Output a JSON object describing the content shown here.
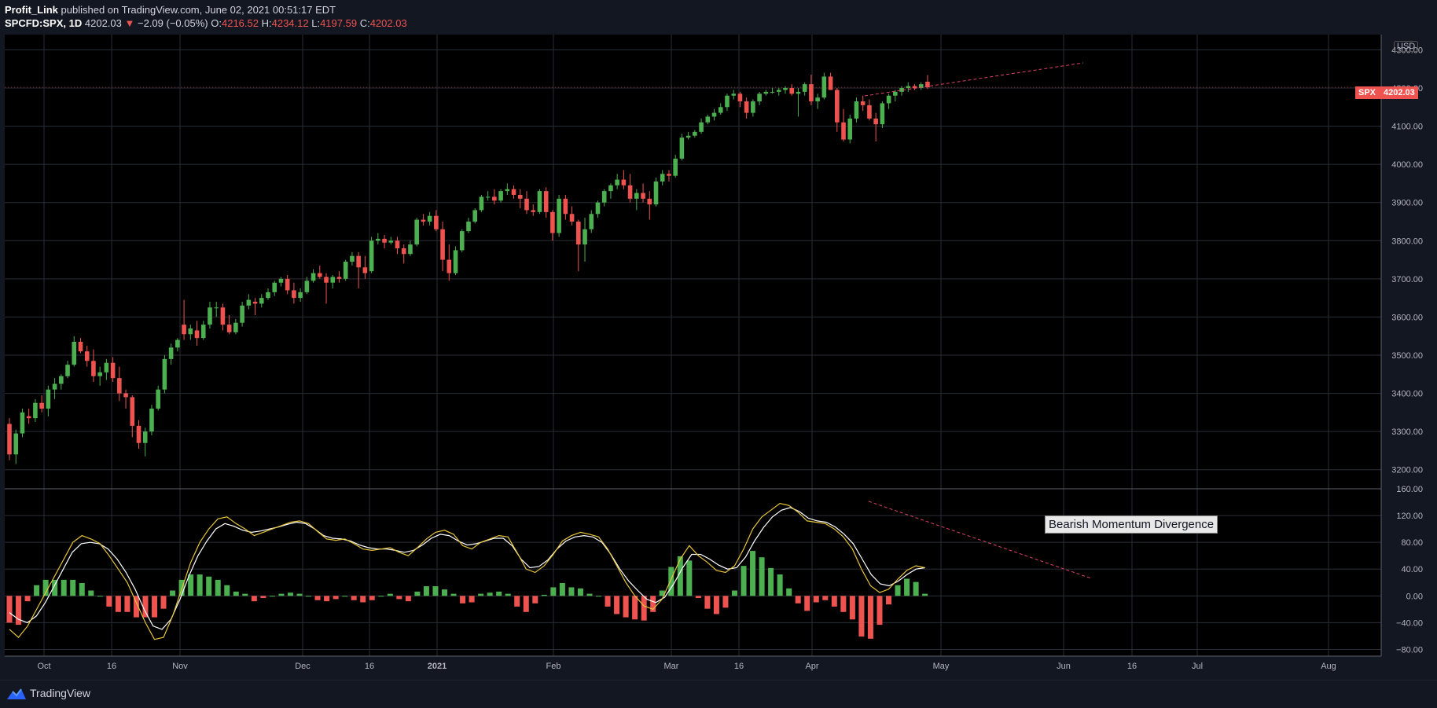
{
  "header": {
    "publisher": "Profit_Link",
    "published_text": "published on TradingView.com, June 02, 2021 00:51:17 EDT",
    "symbol": "SPCFD:SPX, 1D",
    "last": "4202.03",
    "change": "−2.09 (−0.05%)",
    "o_label": "O:",
    "o_value": "4216.52",
    "h_label": "H:",
    "h_value": "4234.12",
    "l_label": "L:",
    "l_value": "4197.59",
    "c_label": "C:",
    "c_value": "4202.03"
  },
  "price_scale": {
    "currency": "USD",
    "badge_symbol": "SPX",
    "badge_value": "4202.03"
  },
  "annotation": "Bearish Momentum Divergence",
  "footer": {
    "brand": "TradingView"
  },
  "colors": {
    "up": "#4caf50",
    "down": "#ef5350",
    "grid": "#2a2e39",
    "osc_fast": "#e7c53a",
    "osc_slow": "#ffffff",
    "trendline": "#e0436b"
  },
  "chart_data": [
    {
      "type": "candlestick",
      "x_ticks": [
        "Oct",
        "16",
        "Nov",
        "Dec",
        "16",
        "2021",
        "Feb",
        "Mar",
        "16",
        "Apr",
        "May",
        "Jun",
        "16",
        "Jul",
        "Aug"
      ],
      "y_ticks": [
        "4300.00",
        "4200.00",
        "4100.00",
        "4000.00",
        "3900.00",
        "3800.00",
        "3700.00",
        "3600.00",
        "3500.00",
        "3400.00",
        "3300.00",
        "3200.00"
      ],
      "ylim": [
        3150,
        4340
      ],
      "ohlc_key": [
        "open",
        "high",
        "low",
        "close"
      ],
      "candles": [
        [
          3320,
          3335,
          3225,
          3240
        ],
        [
          3240,
          3305,
          3215,
          3295
        ],
        [
          3295,
          3360,
          3285,
          3350
        ],
        [
          3340,
          3360,
          3320,
          3335
        ],
        [
          3335,
          3385,
          3325,
          3375
        ],
        [
          3375,
          3395,
          3350,
          3360
        ],
        [
          3360,
          3420,
          3340,
          3410
        ],
        [
          3410,
          3440,
          3385,
          3425
        ],
        [
          3425,
          3450,
          3410,
          3445
        ],
        [
          3445,
          3485,
          3440,
          3475
        ],
        [
          3475,
          3550,
          3470,
          3535
        ],
        [
          3535,
          3545,
          3505,
          3510
        ],
        [
          3510,
          3525,
          3470,
          3485
        ],
        [
          3485,
          3515,
          3430,
          3445
        ],
        [
          3445,
          3470,
          3420,
          3455
        ],
        [
          3455,
          3490,
          3435,
          3480
        ],
        [
          3480,
          3495,
          3430,
          3440
        ],
        [
          3440,
          3470,
          3380,
          3400
        ],
        [
          3400,
          3410,
          3360,
          3390
        ],
        [
          3390,
          3395,
          3285,
          3315
        ],
        [
          3315,
          3330,
          3255,
          3270
        ],
        [
          3270,
          3310,
          3235,
          3300
        ],
        [
          3300,
          3370,
          3290,
          3360
        ],
        [
          3360,
          3420,
          3355,
          3410
        ],
        [
          3410,
          3500,
          3400,
          3490
        ],
        [
          3490,
          3530,
          3475,
          3520
        ],
        [
          3520,
          3545,
          3510,
          3540
        ],
        [
          3580,
          3645,
          3540,
          3555
        ],
        [
          3555,
          3580,
          3540,
          3570
        ],
        [
          3565,
          3590,
          3525,
          3545
        ],
        [
          3545,
          3590,
          3540,
          3580
        ],
        [
          3580,
          3640,
          3570,
          3625
        ],
        [
          3625,
          3640,
          3600,
          3625
        ],
        [
          3625,
          3635,
          3565,
          3580
        ],
        [
          3580,
          3605,
          3555,
          3560
        ],
        [
          3560,
          3595,
          3555,
          3585
        ],
        [
          3585,
          3640,
          3575,
          3630
        ],
        [
          3630,
          3660,
          3620,
          3645
        ],
        [
          3640,
          3650,
          3605,
          3635
        ],
        [
          3635,
          3660,
          3625,
          3650
        ],
        [
          3650,
          3675,
          3645,
          3665
        ],
        [
          3665,
          3695,
          3655,
          3690
        ],
        [
          3690,
          3705,
          3680,
          3700
        ],
        [
          3700,
          3710,
          3660,
          3670
        ],
        [
          3670,
          3690,
          3635,
          3650
        ],
        [
          3650,
          3675,
          3640,
          3665
        ],
        [
          3665,
          3705,
          3660,
          3695
        ],
        [
          3695,
          3725,
          3690,
          3715
        ],
        [
          3715,
          3735,
          3700,
          3705
        ],
        [
          3705,
          3715,
          3635,
          3690
        ],
        [
          3690,
          3710,
          3675,
          3705
        ],
        [
          3705,
          3720,
          3690,
          3700
        ],
        [
          3700,
          3750,
          3695,
          3745
        ],
        [
          3745,
          3770,
          3735,
          3760
        ],
        [
          3760,
          3770,
          3675,
          3730
        ],
        [
          3730,
          3760,
          3700,
          3715
        ],
        [
          3720,
          3810,
          3715,
          3800
        ],
        [
          3800,
          3820,
          3790,
          3805
        ],
        [
          3805,
          3815,
          3780,
          3795
        ],
        [
          3795,
          3810,
          3790,
          3800
        ],
        [
          3800,
          3810,
          3765,
          3780
        ],
        [
          3780,
          3790,
          3740,
          3765
        ],
        [
          3765,
          3800,
          3760,
          3790
        ],
        [
          3790,
          3860,
          3785,
          3855
        ],
        [
          3855,
          3870,
          3840,
          3850
        ],
        [
          3850,
          3875,
          3840,
          3865
        ],
        [
          3865,
          3880,
          3825,
          3830
        ],
        [
          3830,
          3850,
          3720,
          3750
        ],
        [
          3750,
          3790,
          3695,
          3715
        ],
        [
          3715,
          3785,
          3710,
          3775
        ],
        [
          3775,
          3830,
          3770,
          3825
        ],
        [
          3825,
          3860,
          3820,
          3850
        ],
        [
          3850,
          3885,
          3845,
          3880
        ],
        [
          3880,
          3920,
          3875,
          3915
        ],
        [
          3915,
          3930,
          3905,
          3915
        ],
        [
          3915,
          3935,
          3895,
          3905
        ],
        [
          3905,
          3935,
          3900,
          3930
        ],
        [
          3930,
          3950,
          3920,
          3935
        ],
        [
          3935,
          3945,
          3910,
          3920
        ],
        [
          3920,
          3935,
          3885,
          3910
        ],
        [
          3910,
          3930,
          3870,
          3880
        ],
        [
          3880,
          3895,
          3865,
          3875
        ],
        [
          3875,
          3935,
          3870,
          3930
        ],
        [
          3930,
          3940,
          3860,
          3875
        ],
        [
          3875,
          3880,
          3800,
          3820
        ],
        [
          3820,
          3920,
          3810,
          3910
        ],
        [
          3910,
          3920,
          3855,
          3870
        ],
        [
          3870,
          3890,
          3840,
          3850
        ],
        [
          3850,
          3855,
          3720,
          3790
        ],
        [
          3790,
          3860,
          3745,
          3830
        ],
        [
          3830,
          3880,
          3820,
          3870
        ],
        [
          3870,
          3905,
          3860,
          3900
        ],
        [
          3900,
          3935,
          3890,
          3930
        ],
        [
          3930,
          3950,
          3910,
          3945
        ],
        [
          3945,
          3975,
          3935,
          3960
        ],
        [
          3960,
          3985,
          3935,
          3945
        ],
        [
          3945,
          3975,
          3900,
          3910
        ],
        [
          3910,
          3935,
          3880,
          3925
        ],
        [
          3925,
          3950,
          3900,
          3910
        ],
        [
          3910,
          3930,
          3855,
          3895
        ],
        [
          3895,
          3965,
          3890,
          3955
        ],
        [
          3955,
          3985,
          3945,
          3975
        ],
        [
          3975,
          3985,
          3955,
          3970
        ],
        [
          3970,
          4025,
          3965,
          4015
        ],
        [
          4015,
          4080,
          4010,
          4070
        ],
        [
          4070,
          4085,
          4065,
          4075
        ],
        [
          4075,
          4090,
          4070,
          4085
        ],
        [
          4085,
          4120,
          4080,
          4110
        ],
        [
          4110,
          4130,
          4105,
          4125
        ],
        [
          4125,
          4145,
          4115,
          4135
        ],
        [
          4135,
          4160,
          4130,
          4150
        ],
        [
          4150,
          4185,
          4140,
          4180
        ],
        [
          4180,
          4195,
          4170,
          4185
        ],
        [
          4185,
          4190,
          4150,
          4165
        ],
        [
          4165,
          4175,
          4120,
          4135
        ],
        [
          4135,
          4170,
          4125,
          4165
        ],
        [
          4165,
          4190,
          4155,
          4185
        ],
        [
          4185,
          4195,
          4180,
          4190
        ],
        [
          4190,
          4200,
          4185,
          4190
        ],
        [
          4190,
          4200,
          4180,
          4195
        ],
        [
          4195,
          4205,
          4185,
          4200
        ],
        [
          4200,
          4210,
          4180,
          4185
        ],
        [
          4185,
          4200,
          4125,
          4190
        ],
        [
          4190,
          4215,
          4180,
          4210
        ],
        [
          4210,
          4235,
          4155,
          4165
        ],
        [
          4165,
          4185,
          4145,
          4175
        ],
        [
          4175,
          4240,
          4170,
          4230
        ],
        [
          4230,
          4240,
          4195,
          4195
        ],
        [
          4195,
          4200,
          4085,
          4110
        ],
        [
          4110,
          4145,
          4060,
          4065
        ],
        [
          4065,
          4130,
          4055,
          4120
        ],
        [
          4120,
          4175,
          4110,
          4165
        ],
        [
          4165,
          4180,
          4140,
          4155
        ],
        [
          4155,
          4170,
          4115,
          4120
        ],
        [
          4120,
          4135,
          4060,
          4105
        ],
        [
          4105,
          4165,
          4095,
          4160
        ],
        [
          4160,
          4185,
          4145,
          4180
        ],
        [
          4180,
          4195,
          4165,
          4190
        ],
        [
          4190,
          4205,
          4180,
          4200
        ],
        [
          4200,
          4215,
          4190,
          4205
        ],
        [
          4205,
          4210,
          4195,
          4200
        ],
        [
          4200,
          4215,
          4195,
          4210
        ],
        [
          4216.52,
          4234.12,
          4197.59,
          4202.03
        ]
      ]
    },
    {
      "type": "oscillator",
      "y_ticks": [
        "160.00",
        "120.00",
        "80.00",
        "40.00",
        "0.00",
        "−40.00",
        "−80.00"
      ],
      "ylim": [
        -90,
        160
      ],
      "series": [
        {
          "values": [
            -50,
            -62,
            -45,
            -20,
            5,
            30,
            55,
            80,
            90,
            85,
            78,
            60,
            40,
            20,
            -10,
            -40,
            -65,
            -62,
            -30,
            10,
            50,
            80,
            100,
            115,
            118,
            108,
            100,
            90,
            95,
            100,
            105,
            110,
            112,
            108,
            96,
            85,
            83,
            85,
            78,
            70,
            68,
            70,
            72,
            65,
            60,
            72,
            85,
            95,
            98,
            92,
            75,
            70,
            80,
            85,
            90,
            88,
            65,
            40,
            35,
            45,
            62,
            82,
            90,
            95,
            92,
            88,
            70,
            45,
            20,
            0,
            -15,
            -20,
            -5,
            25,
            55,
            75,
            60,
            50,
            38,
            35,
            45,
            70,
            100,
            118,
            128,
            138,
            135,
            125,
            112,
            110,
            108,
            100,
            88,
            70,
            40,
            15,
            5,
            10,
            25,
            38,
            45,
            42
          ]
        },
        {
          "values": [
            -25,
            -35,
            -40,
            -30,
            -10,
            15,
            40,
            65,
            78,
            80,
            78,
            70,
            55,
            35,
            10,
            -20,
            -45,
            -50,
            -35,
            -5,
            30,
            60,
            82,
            100,
            108,
            104,
            98,
            95,
            97,
            100,
            103,
            107,
            110,
            108,
            100,
            90,
            86,
            85,
            82,
            76,
            72,
            70,
            70,
            68,
            65,
            68,
            76,
            86,
            92,
            90,
            82,
            76,
            78,
            82,
            86,
            86,
            75,
            55,
            42,
            44,
            54,
            70,
            82,
            88,
            90,
            88,
            80,
            62,
            40,
            22,
            8,
            -5,
            -10,
            -2,
            18,
            42,
            62,
            62,
            55,
            46,
            40,
            42,
            58,
            82,
            102,
            118,
            128,
            132,
            126,
            116,
            112,
            110,
            103,
            92,
            78,
            55,
            32,
            18,
            15,
            22,
            32,
            40,
            42
          ]
        }
      ]
    }
  ]
}
